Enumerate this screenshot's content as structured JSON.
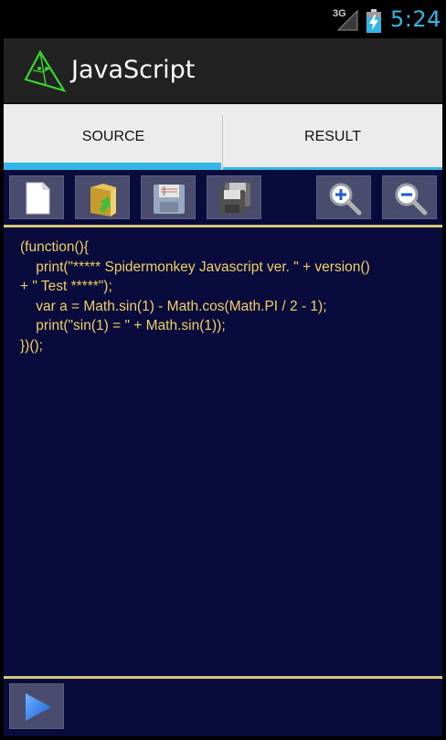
{
  "status_bar": {
    "network": "3G",
    "time": "5:24"
  },
  "action_bar": {
    "title": "JavaScript"
  },
  "tabs": [
    {
      "label": "SOURCE",
      "selected": true
    },
    {
      "label": "RESULT",
      "selected": false
    }
  ],
  "toolbar": {
    "buttons": [
      "new-file-icon",
      "open-folder-icon",
      "save-icon",
      "save-as-icon",
      "zoom-in-icon",
      "zoom-out-icon"
    ]
  },
  "editor": {
    "code": "(function(){\n    print(\"***** Spidermonkey Javascript ver. \" + version()\n+ \" Test *****\");\n    var a = Math.sin(1) - Math.cos(Math.PI / 2 - 1);\n    print(\"sin(1) = \" + Math.sin(1));\n})();"
  },
  "colors": {
    "accent": "#33b5e5",
    "editor_bg": "#0a0b3d",
    "code_text": "#f0d060",
    "separator": "#d8c774"
  },
  "run_button": {
    "icon": "play-icon"
  }
}
